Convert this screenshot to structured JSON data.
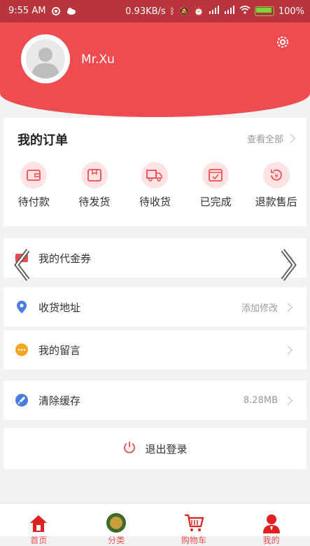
{
  "status_bar": {
    "time": "9:55",
    "ampm": "AM",
    "network_speed": "0.93KB/s",
    "battery": "100%"
  },
  "profile": {
    "username": "Mr.Xu"
  },
  "orders": {
    "title": "我的订单",
    "view_all": "查看全部",
    "items": [
      {
        "label": "待付款",
        "icon": "wallet-icon"
      },
      {
        "label": "待发货",
        "icon": "package-icon"
      },
      {
        "label": "待收货",
        "icon": "truck-icon"
      },
      {
        "label": "已完成",
        "icon": "calendar-check-icon"
      },
      {
        "label": "退款售后",
        "icon": "refund-icon"
      }
    ]
  },
  "menu": {
    "coupons": {
      "label": "我的代金券",
      "icon": "coupon-icon"
    },
    "address": {
      "label": "收货地址",
      "value": "添加修改",
      "icon": "location-icon"
    },
    "messages": {
      "label": "我的留言",
      "icon": "message-icon"
    },
    "cache": {
      "label": "清除缓存",
      "value": "8.28MB",
      "icon": "rocket-icon"
    }
  },
  "logout": {
    "label": "退出登录",
    "icon": "power-icon"
  },
  "tabbar": {
    "tabs": [
      {
        "label": "首页",
        "icon": "home-icon"
      },
      {
        "label": "分类",
        "icon": "category-icon"
      },
      {
        "label": "购物车",
        "icon": "cart-icon"
      },
      {
        "label": "我的",
        "icon": "user-icon"
      }
    ]
  },
  "colors": {
    "accent": "#ef4c52",
    "statusbar": "#b8353e",
    "icon_blue": "#4a7de2",
    "icon_orange": "#f5a623"
  }
}
